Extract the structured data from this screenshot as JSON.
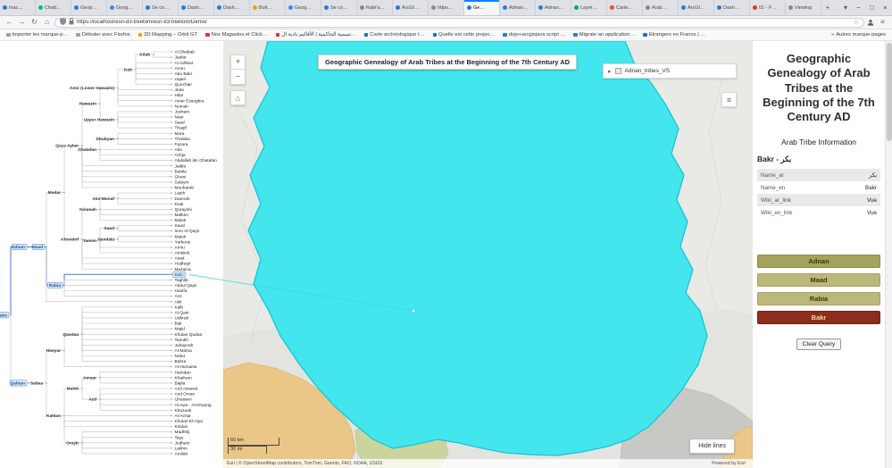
{
  "browser": {
    "tabs": [
      {
        "label": "Inac…",
        "color": "#2b7bd3"
      },
      {
        "label": "Chatt…",
        "color": "#12b886"
      },
      {
        "label": "Geop…",
        "color": "#2b7bd3"
      },
      {
        "label": "Goog…",
        "color": "#4285f4"
      },
      {
        "label": "Se co…",
        "color": "#2b7bd3"
      },
      {
        "label": "Dash…",
        "color": "#2b7bd3"
      },
      {
        "label": "Dash…",
        "color": "#2b7bd3"
      },
      {
        "label": "Bolt…",
        "color": "#f59f00"
      },
      {
        "label": "Goog…",
        "color": "#4285f4"
      },
      {
        "label": "Se co…",
        "color": "#2b7bd3"
      },
      {
        "label": "Rabi'a…",
        "color": "#8a8a8a"
      },
      {
        "label": "ArcGI…",
        "color": "#2b7bd3"
      },
      {
        "label": "https…",
        "color": "#8a8a8a"
      },
      {
        "label": "Ge…",
        "color": "#2b7bd3",
        "active": true
      },
      {
        "label": "Adnan…",
        "color": "#2b7bd3"
      },
      {
        "label": "Adnan…",
        "color": "#2b7bd3"
      },
      {
        "label": "Layer…",
        "color": "#0ca678"
      },
      {
        "label": "Carte…",
        "color": "#e8590c"
      },
      {
        "label": "Arab…",
        "color": "#8a8a8a"
      },
      {
        "label": "ArcGI…",
        "color": "#2b7bd3"
      },
      {
        "label": "Dash…",
        "color": "#2b7bd3"
      },
      {
        "label": "01 - F…",
        "color": "#e03131"
      },
      {
        "label": "Viewing",
        "color": "#8a8a8a"
      }
    ],
    "new_tab_button": "+",
    "tab_list_button": "▾",
    "window_controls": {
      "minimize": "−",
      "maximize": "□",
      "close": "×"
    },
    "nav": {
      "back": "←",
      "forward": "→",
      "reload": "↻",
      "home": "⌂",
      "url": "https://localhost/esri-d3-treetom/esri-d3-treetom/Demo/",
      "bookmark_star": "☆",
      "menu": "≡"
    },
    "bookmarks": [
      {
        "label": "Importer les marque-p…",
        "color": "#9aa0a6"
      },
      {
        "label": "Débuter avec Firefox",
        "color": "#9aa0a6"
      },
      {
        "label": "3D Mapping – Orbit GT",
        "color": "#f59f00"
      },
      {
        "label": "Nos Magasins et Click…",
        "color": "#e03131"
      },
      {
        "label": "تسمية الحاكمية | الأقاليم بادية ال…",
        "color": "#e03131"
      },
      {
        "label": "Carte archéologique t…",
        "color": "#1971c2"
      },
      {
        "label": "Quelle est cette projec…",
        "color": "#1971c2"
      },
      {
        "label": "dojo+arcgisjava script …",
        "color": "#2b7bd3"
      },
      {
        "label": "Migrate an application…",
        "color": "#2b7bd3"
      },
      {
        "label": "Étrangers en France | …",
        "color": "#1971c2"
      }
    ],
    "other_bookmarks_chevron": "»",
    "other_bookmarks": "Autres marque-pages"
  },
  "map": {
    "title": "Geographic Genealogy of Arab Tribes at the Beginning of the 7th Century AD",
    "zoom_in": "+",
    "zoom_out": "−",
    "home_button": "⌂",
    "layer_toggle": {
      "caret": "▸",
      "label": "Adnan_tribes_VS"
    },
    "legend_button": "≡",
    "scale": {
      "km": "60 km",
      "mi": "30 mi"
    },
    "hide_lines_button": "Hide lines",
    "attribution": "Esri | © OpenStreetMap contributors, TomTom, Garmin, FAO, NOAA, USGS",
    "powered_by": "Powered by Esri",
    "colors": {
      "basemap": "#e9eae6",
      "selected_fill": "#44e6ee",
      "selected_stroke": "#18c4d4",
      "desert": "#eac687",
      "vegetation": "#ccd49e",
      "gray_region": "#c8c9c5"
    }
  },
  "sidebar": {
    "title": "Geographic Genealogy of Arab Tribes at the Beginning of the 7th Century AD",
    "subtitle": "Arab Tribe Information",
    "tribe_heading": "Bakr - بكر",
    "info_rows": [
      {
        "label": "Name_ar",
        "value": "بكر",
        "link": false
      },
      {
        "label": "Name_en",
        "value": "Bakr",
        "link": false
      },
      {
        "label": "Wiki_ar_link",
        "value": "Vue",
        "link": true
      },
      {
        "label": "Wiki_en_link",
        "value": "Vue",
        "link": true
      }
    ],
    "lineage_buttons": [
      {
        "label": "Adnan",
        "bg": "#a4a25c",
        "text": "#3c3708",
        "border": "#8d8b46"
      },
      {
        "label": "Maad",
        "bg": "#bcb87c",
        "text": "#3c3708",
        "border": "#a5a164"
      },
      {
        "label": "Rabia",
        "bg": "#bcb87c",
        "text": "#3c3708",
        "border": "#a5a164"
      },
      {
        "label": "Bakr",
        "bg": "#8e2d1d",
        "text": "#f2d996",
        "border": "#6f2013"
      }
    ],
    "clear_query": "Clear Query"
  },
  "tree": {
    "highlight_color": "#3a7fd0",
    "root": {
      "name": "Arabs",
      "hl": true,
      "children": [
        {
          "name": "Adnan",
          "hl": true,
          "children": [
            {
              "name": "Maad",
              "hl": true,
              "children": [
                {
                  "name": "Mudar",
                  "children": [
                    {
                      "name": "Qays Aylan",
                      "children": [
                        {
                          "name": "Hawazin",
                          "children": [
                            {
                              "name": "Amir (Lower Hawazin)",
                              "children": [
                                {
                                  "name": "Kab",
                                  "children": [
                                    {
                                      "name": "Kilab",
                                      "children": [
                                        {
                                          "name": "Al Dhabab"
                                        },
                                        {
                                          "name": "Jaafar"
                                        }
                                      ]
                                    },
                                    {
                                      "name": "Al Adhbat"
                                    },
                                    {
                                      "name": "Amru"
                                    },
                                    {
                                      "name": "Abu Bakr"
                                    },
                                    {
                                      "name": "Uqael"
                                    },
                                    {
                                      "name": "Quochair"
                                    }
                                  ]
                                },
                                {
                                  "name": "Jeda"
                                },
                                {
                                  "name": "Hilal"
                                },
                                {
                                  "name": "Amer Essoghra"
                                },
                                {
                                  "name": "Numair"
                                }
                              ]
                            },
                            {
                              "name": "Upper Hawazin",
                              "children": [
                                {
                                  "name": "Jusham"
                                },
                                {
                                  "name": "Nasr"
                                },
                                {
                                  "name": "Saad"
                                },
                                {
                                  "name": "Thaqif"
                                }
                              ]
                            }
                          ]
                        },
                        {
                          "name": "Ghatafan",
                          "children": [
                            {
                              "name": "Dhubyan",
                              "children": [
                                {
                                  "name": "Mora"
                                },
                                {
                                  "name": "Thalaba"
                                },
                                {
                                  "name": "Fazara"
                                }
                              ]
                            },
                            {
                              "name": "Abs"
                            },
                            {
                              "name": "Achja"
                            },
                            {
                              "name": "Abdallah ibn Ghatafan"
                            }
                          ]
                        },
                        {
                          "name": "Jadila"
                        },
                        {
                          "name": "Bahila"
                        },
                        {
                          "name": "Ghani"
                        },
                        {
                          "name": "Sulaym"
                        },
                        {
                          "name": "Mouhareb"
                        }
                      ]
                    },
                    {
                      "name": "Khondof",
                      "children": [
                        {
                          "name": "Kinanah",
                          "children": [
                            {
                              "name": "Abd Monaf",
                              "children": [
                                {
                                  "name": "Layth"
                                },
                                {
                                  "name": "Damrah"
                                },
                                {
                                  "name": "Doal"
                                }
                              ]
                            },
                            {
                              "name": "Qurayshi"
                            },
                            {
                              "name": "Malken"
                            },
                            {
                              "name": "Malek"
                            }
                          ]
                        },
                        {
                          "name": "Tamim",
                          "children": [
                            {
                              "name": "Saad",
                              "children": [
                                {
                                  "name": "Saad"
                                },
                                {
                                  "name": "Imru Al-Qays"
                                }
                              ]
                            },
                            {
                              "name": "Handala",
                              "children": [
                                {
                                  "name": "Malek"
                                },
                                {
                                  "name": "Yarbooe"
                                }
                              ]
                            },
                            {
                              "name": "Amru"
                            },
                            {
                              "name": "Arrabeb"
                            }
                          ]
                        },
                        {
                          "name": "Asad"
                        },
                        {
                          "name": "Hudhayl"
                        },
                        {
                          "name": "Muzaina"
                        }
                      ]
                    }
                  ]
                },
                {
                  "name": "Rabia",
                  "hl": true,
                  "children": [
                    {
                      "name": "Bakr",
                      "hl": true
                    },
                    {
                      "name": "Taghlib"
                    },
                    {
                      "name": "Abdul Qays"
                    },
                    {
                      "name": "Hanifa"
                    },
                    {
                      "name": "Anz"
                    }
                  ]
                },
                {
                  "name": "Akk"
                }
              ]
            }
          ]
        },
        {
          "name": "Qahtan",
          "box": true,
          "children": [
            {
              "name": "Sabaa",
              "children": [
                {
                  "name": "Himyar",
                  "children": [
                    {
                      "name": "Qaodaa",
                      "children": [
                        {
                          "name": "Kalb"
                        },
                        {
                          "name": "Al-Qain"
                        },
                        {
                          "name": "Udhrah"
                        },
                        {
                          "name": "Bali"
                        },
                        {
                          "name": "Majid"
                        },
                        {
                          "name": "Khulan Qudaa"
                        },
                        {
                          "name": "Tanukh"
                        },
                        {
                          "name": "Juhaynah"
                        },
                        {
                          "name": "Al-Mahra"
                        },
                        {
                          "name": "Nahd"
                        },
                        {
                          "name": "Bahra"
                        }
                      ]
                    },
                    {
                      "name": "Al-Humaisa"
                    }
                  ]
                },
                {
                  "name": "Kahlan",
                  "children": [
                    {
                      "name": "Malek",
                      "children": [
                        {
                          "name": "Amaar",
                          "children": [
                            {
                              "name": "Hamdan"
                            },
                            {
                              "name": "Khatham"
                            },
                            {
                              "name": "Bajila"
                            }
                          ]
                        },
                        {
                          "name": "Azd",
                          "children": [
                            {
                              "name": "Azd Assarat"
                            },
                            {
                              "name": "Azd Oman"
                            },
                            {
                              "name": "Ghassen"
                            },
                            {
                              "name": "Al-Aws - Al-Khazraj"
                            },
                            {
                              "name": "Khuzaah"
                            }
                          ]
                        }
                      ]
                    },
                    {
                      "name": "Al-Achar"
                    },
                    {
                      "name": "Khulan El-Alya"
                    },
                    {
                      "name": "Kindan"
                    },
                    {
                      "name": "Orayb",
                      "children": [
                        {
                          "name": "Madhhij"
                        },
                        {
                          "name": "Tayy"
                        },
                        {
                          "name": "Judham"
                        },
                        {
                          "name": "Lakhm"
                        },
                        {
                          "name": "Amilah"
                        }
                      ]
                    }
                  ]
                }
              ]
            }
          ]
        }
      ]
    }
  }
}
